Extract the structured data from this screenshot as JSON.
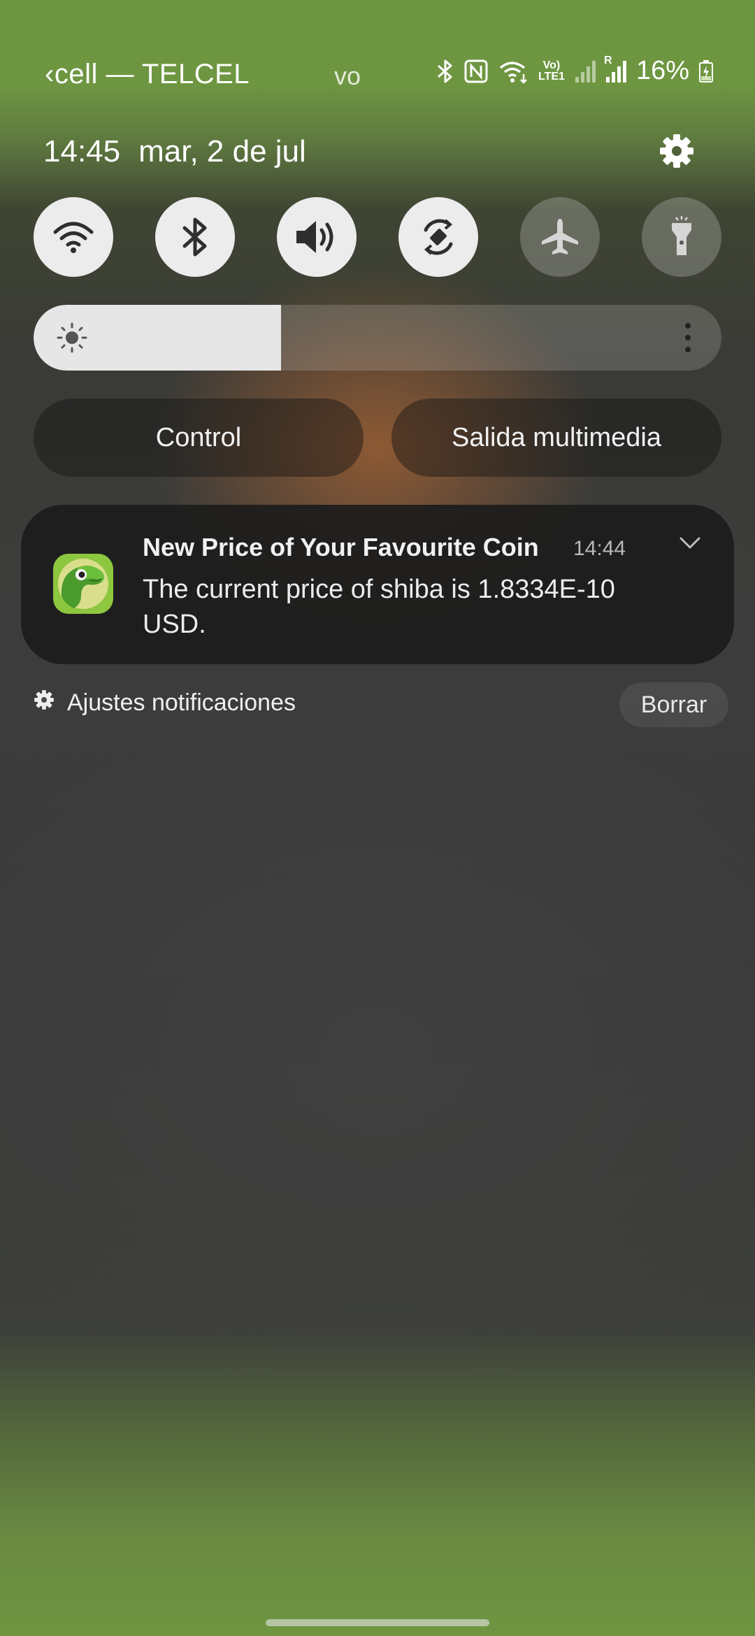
{
  "status_bar": {
    "carrier": "‹cell — TELCEL",
    "network_label": "vo",
    "battery_percent": "16%",
    "volte_label": "Vo)",
    "lte_label": "LTE1",
    "roaming_label": "R",
    "icons": [
      "bluetooth-icon",
      "nfc-icon",
      "wifi-icon",
      "volte-icon",
      "signal-icon",
      "signal-roaming-icon",
      "battery-charging-icon"
    ]
  },
  "header": {
    "time": "14:45",
    "date": "mar, 2 de jul",
    "settings_icon": "gear-icon"
  },
  "quick_toggles": [
    {
      "name": "wifi",
      "icon": "wifi-icon",
      "state": "on"
    },
    {
      "name": "bluetooth",
      "icon": "bluetooth-icon",
      "state": "on"
    },
    {
      "name": "sound",
      "icon": "volume-icon",
      "state": "on"
    },
    {
      "name": "auto-rotate",
      "icon": "rotate-icon",
      "state": "on"
    },
    {
      "name": "airplane-mode",
      "icon": "airplane-icon",
      "state": "off"
    },
    {
      "name": "flashlight",
      "icon": "flashlight-icon",
      "state": "off"
    }
  ],
  "brightness": {
    "level": 0.36,
    "icon": "sun-icon",
    "more_icon": "more-vertical-icon"
  },
  "buttons": {
    "control_label": "Control",
    "media_output_label": "Salida multimedia"
  },
  "notification": {
    "icon": "coingecko-app-icon",
    "title": "New Price of Your Favourite Coin",
    "time": "14:44",
    "body": "The current price of shiba is 1.8334E-10 USD."
  },
  "notification_footer": {
    "settings_label": "Ajustes notificaciones",
    "clear_label": "Borrar"
  },
  "colors": {
    "toggle_on": "#ececec",
    "toggle_icon_on": "#2e2e2e",
    "toggle_off": "rgba(255,255,255,0.22)",
    "wallpaper_green": "#6e9641"
  }
}
